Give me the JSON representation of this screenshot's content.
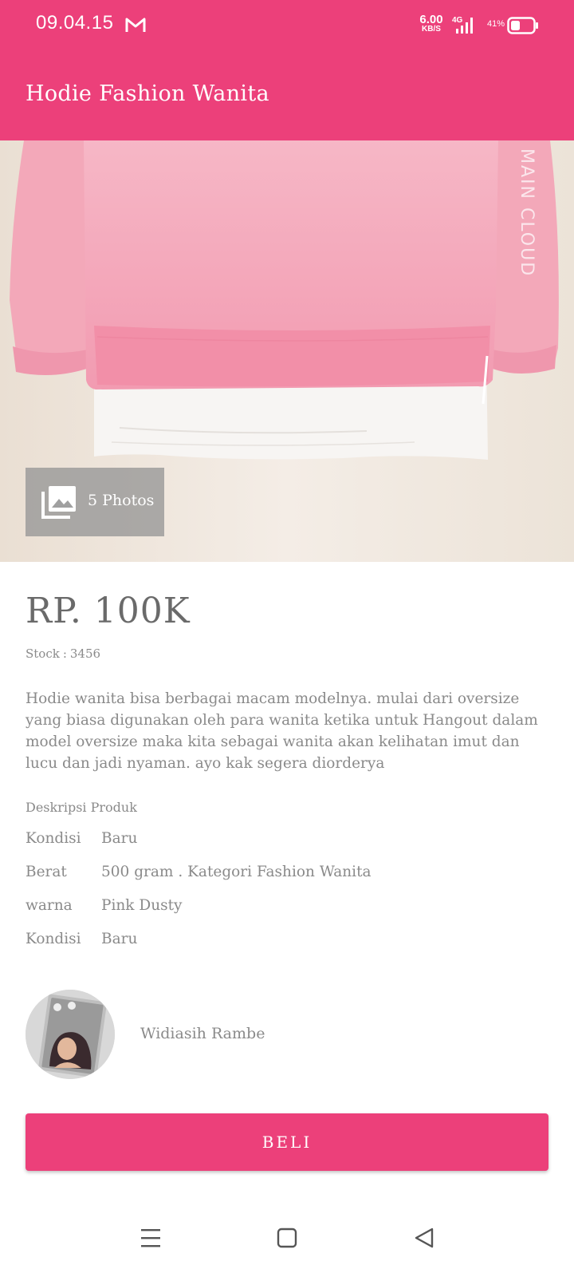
{
  "status_bar": {
    "time": "09.04.15",
    "net_speed_value": "6.00",
    "net_speed_unit": "KB/S",
    "network": "4G",
    "battery_percent": "41%"
  },
  "app_bar": {
    "title": "Hodie Fashion Wanita"
  },
  "gallery": {
    "photos_label": "5 Photos"
  },
  "product": {
    "price": "RP. 100K",
    "stock_label": "Stock",
    "stock_value": "3456",
    "description": "Hodie wanita bisa berbagai macam modelnya. mulai dari oversize yang biasa digunakan oleh para wanita ketika untuk Hangout dalam model oversize maka kita sebagai wanita akan kelihatan imut dan lucu dan jadi nyaman. ayo kak segera diorderya",
    "spec_title": "Deskripsi Produk",
    "specs": [
      {
        "key": "Kondisi",
        "value": "Baru"
      },
      {
        "key": "Berat",
        "value": "500 gram . Kategori Fashion Wanita"
      },
      {
        "key": "warna",
        "value": "Pink Dusty"
      },
      {
        "key": "Kondisi",
        "value": "Baru"
      }
    ]
  },
  "seller": {
    "name": "Widiasih Rambe"
  },
  "buy_button": {
    "label": "BELI"
  },
  "colors": {
    "primary": "#ec407a",
    "hoodie": "#f4a3b6"
  },
  "icons": {
    "mail": "gmail-icon",
    "signal": "signal-icon",
    "battery": "battery-icon",
    "gallery": "gallery-icon",
    "nav_menu": "menu-icon",
    "nav_home": "home-icon",
    "nav_back": "back-icon"
  }
}
